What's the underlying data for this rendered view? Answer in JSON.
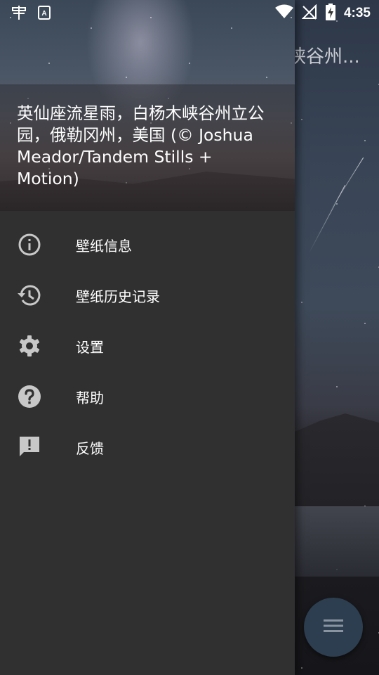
{
  "status_bar": {
    "time": "4:35",
    "left_icons": [
      "app-notification-icon",
      "translate-icon"
    ],
    "right_icons": [
      "wifi-icon",
      "signal-off-icon",
      "battery-charging-icon"
    ]
  },
  "background": {
    "title_partial": "峡谷州..."
  },
  "drawer": {
    "header_caption": "英仙座流星雨，白杨木峡谷州立公园，俄勒冈州，美国 (© Joshua Meador/Tandem Stills + Motion)",
    "items": [
      {
        "label": "壁纸信息",
        "icon": "info-icon"
      },
      {
        "label": "壁纸历史记录",
        "icon": "history-icon"
      },
      {
        "label": "设置",
        "icon": "settings-gear-icon"
      },
      {
        "label": "帮助",
        "icon": "help-icon"
      },
      {
        "label": "反馈",
        "icon": "feedback-icon"
      }
    ]
  },
  "fab": {
    "icon": "menu-icon"
  },
  "colors": {
    "drawer_bg": "#303030",
    "text": "#ffffff",
    "icon": "#c8c8c8",
    "fab": "#2c3e50"
  }
}
